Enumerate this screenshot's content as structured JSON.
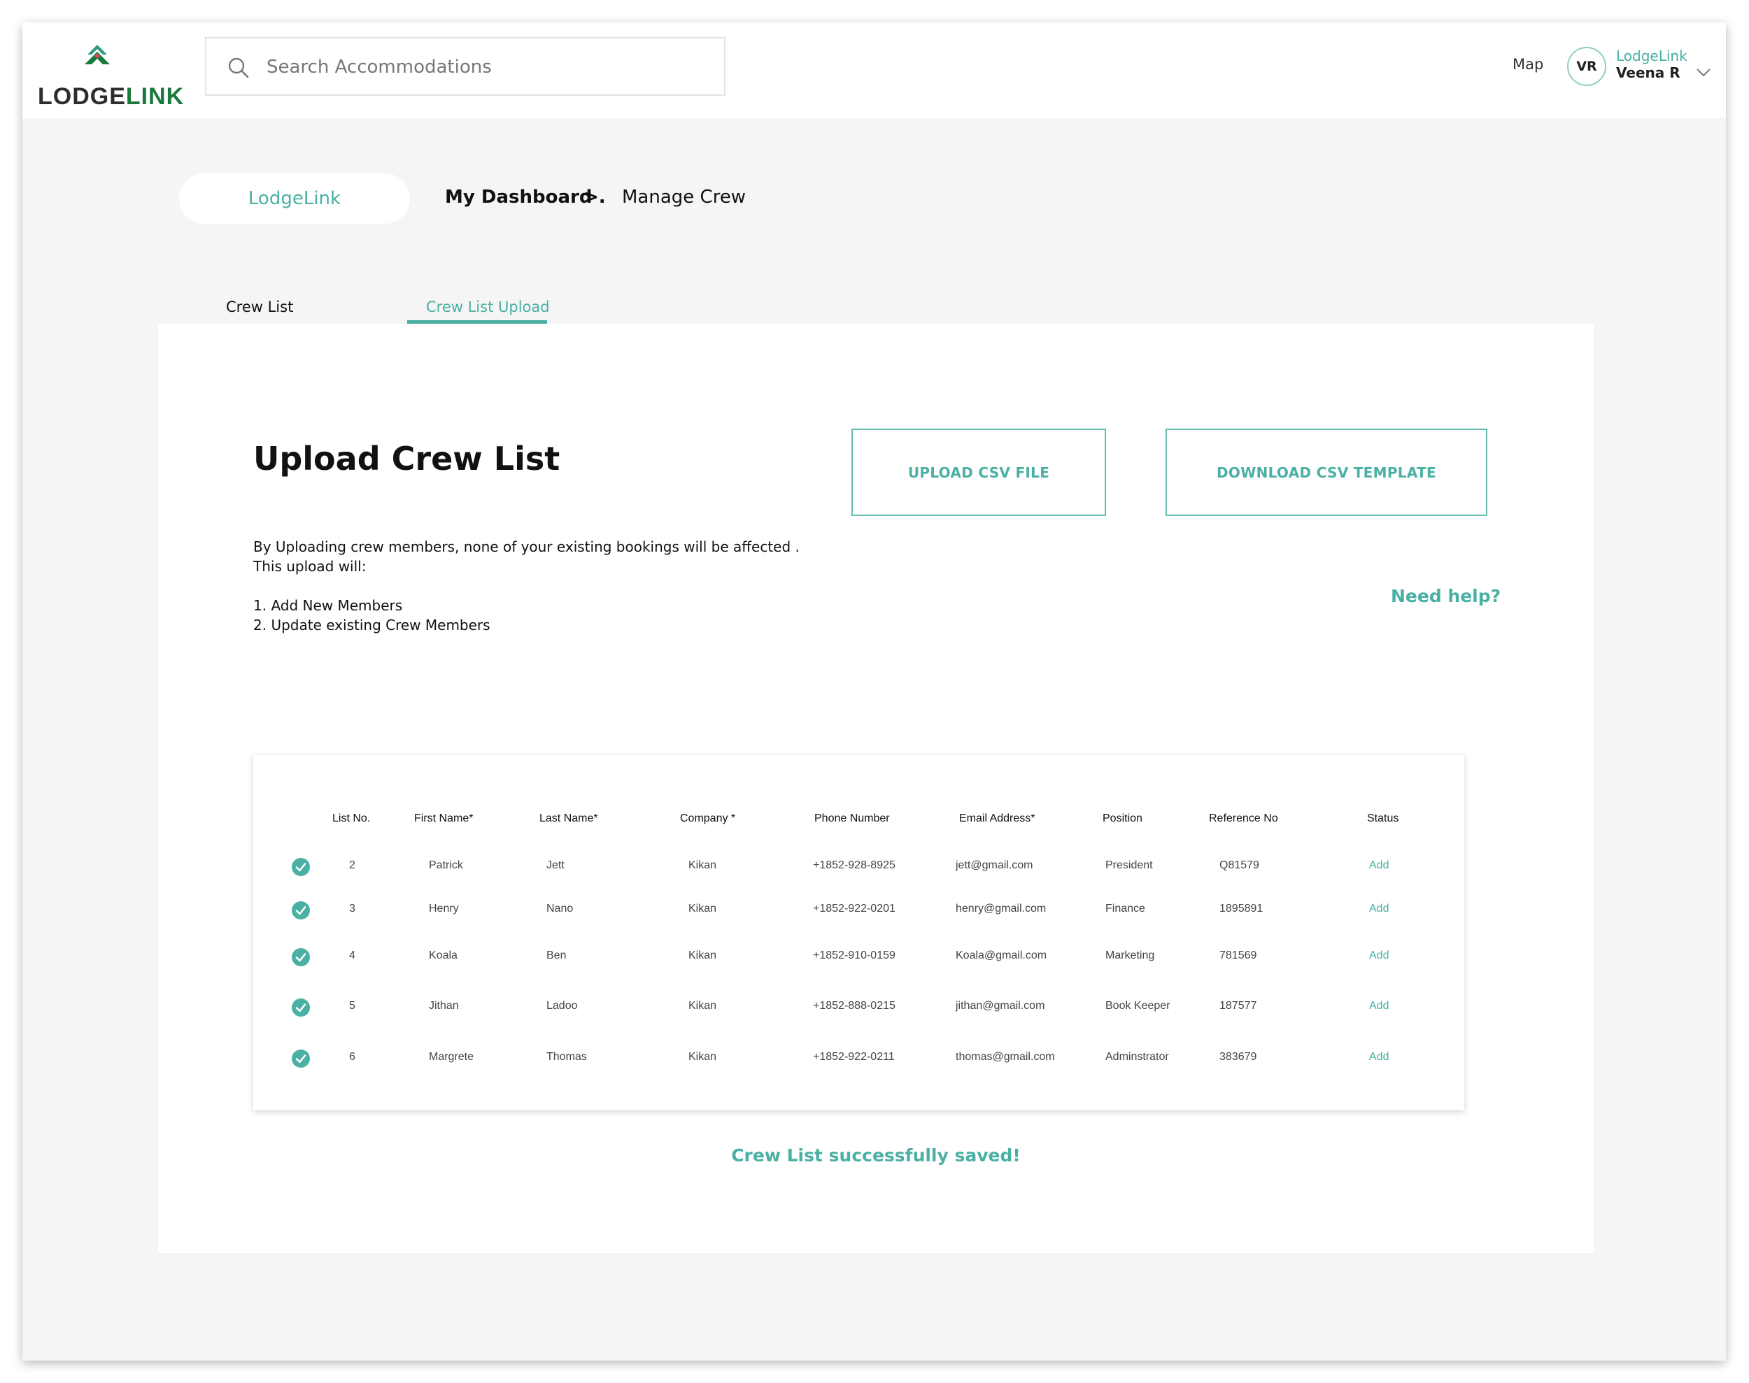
{
  "header": {
    "logo": {
      "word_dark": "LODGE",
      "word_green": "LINK"
    },
    "search": {
      "placeholder": "Search Accommodations"
    },
    "map_label": "Map",
    "user": {
      "initials": "VR",
      "org": "LodgeLink",
      "name": "Veena R"
    }
  },
  "breadcrumb": {
    "home_pill": "LodgeLink",
    "dashboard": "My Dashboard",
    "separator": ">.",
    "current": "Manage Crew"
  },
  "tabs": [
    {
      "label": "Crew List",
      "active": false
    },
    {
      "label": "Crew List Upload",
      "active": true
    }
  ],
  "upload": {
    "title": "Upload Crew List",
    "desc_line1": "By Uploading crew members, none of your existing bookings will be affected .",
    "desc_line2": "This upload will:",
    "item1": "1. Add New Members",
    "item2": "2. Update existing Crew Members",
    "upload_button": "UPLOAD CSV FILE",
    "download_button": "DOWNLOAD CSV TEMPLATE",
    "help_link": "Need help?"
  },
  "table": {
    "headers": [
      "List No.",
      "First Name*",
      "Last Name*",
      "Company *",
      "Phone Number",
      "Email Address*",
      "Position",
      "Reference No",
      "Status"
    ],
    "rows": [
      [
        "2",
        "Patrick",
        "Jett",
        "Kikan",
        "+1852-928-8925",
        "jett@gmail.com",
        "President",
        "Q81579",
        "Add"
      ],
      [
        "3",
        "Henry",
        "Nano",
        "Kikan",
        "+1852-922-0201",
        "henry@gmail.com",
        "Finance",
        "1895891",
        "Add"
      ],
      [
        "4",
        "Koala",
        "Ben",
        "Kikan",
        "+1852-910-0159",
        "Koala@gmail.com",
        "Marketing",
        "781569",
        "Add"
      ],
      [
        "5",
        "Jithan",
        "Ladoo",
        "Kikan",
        "+1852-888-0215",
        "jithan@gmail.com",
        "Book Keeper",
        "187577",
        "Add"
      ],
      [
        "6",
        "Margrete",
        "Thomas",
        "Kikan",
        "+1852-922-0211",
        "thomas@gmail.com",
        "Adminstrator",
        "383679",
        "Add"
      ]
    ]
  },
  "saved_message": "Crew List successfully saved!",
  "colors": {
    "accent": "#49b0a3",
    "brand_green": "#1a7a3c",
    "background": "#f5f5f5"
  },
  "icons": [
    "lodgelink-logo-icon",
    "search-icon",
    "chevron-down-icon",
    "check-circle-icon"
  ]
}
